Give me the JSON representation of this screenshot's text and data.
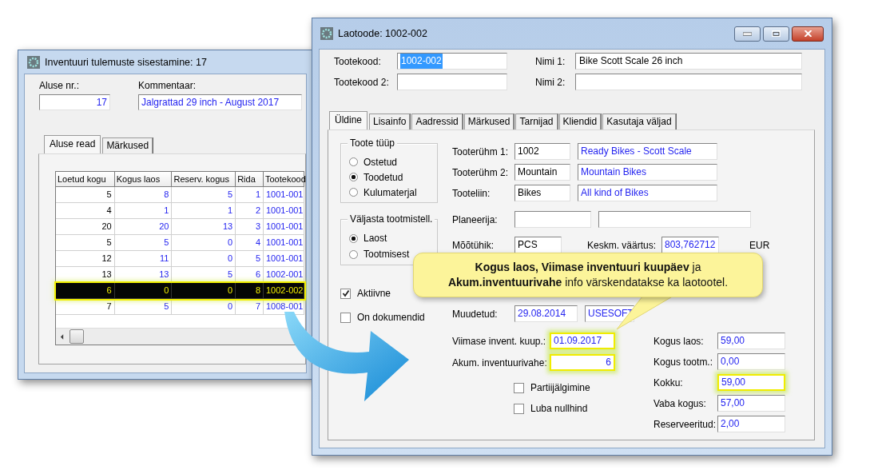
{
  "back_window": {
    "title": "Inventuuri tulemuste sisestamine: 17",
    "fields": [
      {
        "label": "Aluse nr.:",
        "value": "17",
        "kind": "number"
      },
      {
        "label": "Kommentaar:",
        "value": "Jalgrattad 29 inch - August 2017",
        "kind": "text"
      }
    ],
    "tabs": [
      {
        "label": "Aluse read",
        "selected": true
      },
      {
        "label": "Märkused",
        "selected": false
      }
    ],
    "table": {
      "columns": [
        "Loetud kogu",
        "Kogus laos",
        "Reserv. kogus",
        "Rida",
        "Tootekood"
      ],
      "rows": [
        {
          "cells": [
            "5",
            "8",
            "5",
            "1",
            "1001-001"
          ],
          "selected": false
        },
        {
          "cells": [
            "4",
            "1",
            "1",
            "2",
            "1001-001"
          ],
          "selected": false
        },
        {
          "cells": [
            "20",
            "20",
            "13",
            "3",
            "1001-001"
          ],
          "selected": false
        },
        {
          "cells": [
            "5",
            "5",
            "0",
            "4",
            "1001-001"
          ],
          "selected": false
        },
        {
          "cells": [
            "12",
            "11",
            "0",
            "5",
            "1001-001"
          ],
          "selected": false
        },
        {
          "cells": [
            "13",
            "13",
            "5",
            "6",
            "1002-001"
          ],
          "selected": false
        },
        {
          "cells": [
            "6",
            "0",
            "0",
            "8",
            "1002-002"
          ],
          "selected": true
        },
        {
          "cells": [
            "7",
            "5",
            "0",
            "7",
            "1008-001"
          ],
          "selected": false
        }
      ]
    }
  },
  "front_window": {
    "title": "Laotoode: 1002-002",
    "header_fields": [
      {
        "label": "Tootekood:",
        "value": "1002-002",
        "value_selected": true
      },
      {
        "label": "Nimi 1:",
        "value": "Bike Scott Scale 26 inch",
        "value_selected": false
      },
      {
        "label": "Tootekood 2:"
      },
      {
        "label": "Nimi 2:"
      }
    ],
    "tabs": [
      {
        "label": "Üldine",
        "selected": true
      },
      {
        "label": "Lisainfo",
        "selected": false
      },
      {
        "label": "Aadressid",
        "selected": false
      },
      {
        "label": "Märkused",
        "selected": false
      },
      {
        "label": "Tarnijad",
        "selected": false
      },
      {
        "label": "Kliendid",
        "selected": false
      },
      {
        "label": "Kasutaja väljad",
        "selected": false
      }
    ],
    "product_type": {
      "title": "Toote tüüp",
      "options": [
        {
          "label": "Ostetud",
          "selected": false
        },
        {
          "label": "Toodetud",
          "selected": true
        },
        {
          "label": "Kulumaterjal",
          "selected": false
        }
      ]
    },
    "issue_from": {
      "title": "Väljasta tootmistell.",
      "options": [
        {
          "label": "Laost",
          "selected": true
        },
        {
          "label": "Tootmisest",
          "selected": false
        }
      ]
    },
    "flags": [
      {
        "label": "Aktiivne",
        "checked": true
      },
      {
        "label": "On dokumendid",
        "checked": false
      }
    ],
    "groups": [
      {
        "label": "Tooterühm 1:",
        "code": "1002",
        "name": "Ready Bikes - Scott Scale"
      },
      {
        "label": "Tooterühm 2:",
        "code": "Mountain",
        "name": "Mountain Bikes"
      },
      {
        "label": "Tooteliin:",
        "code": "Bikes",
        "name": "All kind of Bikes"
      }
    ],
    "planner_label": "Planeerija:",
    "unit": {
      "label": "Mõõtühik:",
      "value": "PCS"
    },
    "average_value": {
      "label": "Keskm. väärtus:",
      "value": "803,762712",
      "currency": "EUR"
    },
    "modified": {
      "label": "Muudetud:",
      "date": "29.08.2014",
      "user": "USESOFT"
    },
    "inventory": [
      {
        "label": "Viimase invent. kuup.:",
        "value": "01.09.2017",
        "kind": "date",
        "highlighted": true
      },
      {
        "label": "Akum. inventuurivahe:",
        "value": "6",
        "kind": "number",
        "highlighted": true
      }
    ],
    "options": [
      {
        "label": "Partiijälgimine",
        "checked": false
      },
      {
        "label": "Luba nullhind",
        "checked": false
      }
    ],
    "quantities": [
      {
        "label": "Kogus laos:",
        "value": "59,00",
        "highlighted": false
      },
      {
        "label": "Kogus tootm.:",
        "value": "0,00",
        "highlighted": false
      },
      {
        "label": "Kokku:",
        "value": "59,00",
        "highlighted": true
      },
      {
        "label": "Vaba kogus:",
        "value": "57,00",
        "highlighted": false
      },
      {
        "label": "Reserveeritud:",
        "value": "2,00",
        "highlighted": false
      }
    ]
  },
  "callout": {
    "text": "**Kogus laos, Viimase inventuuri kuupäev** ja **Akum.inventuurivahe** info värskendatakse ka laotootel."
  }
}
